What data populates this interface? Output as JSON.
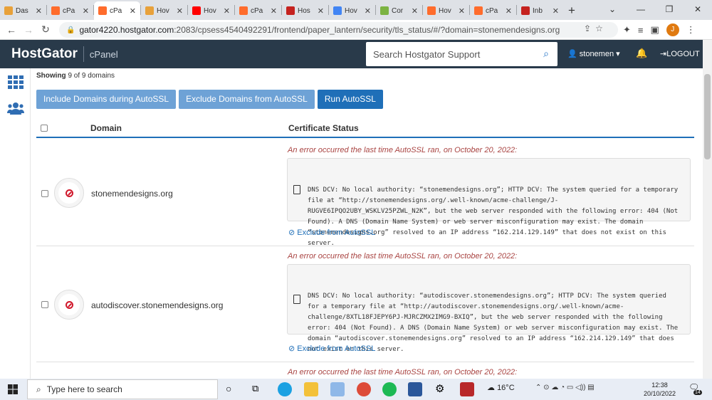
{
  "browser": {
    "tabs": [
      {
        "title": "Das",
        "color": "#e8a13a"
      },
      {
        "title": "cPa",
        "color": "#ff6c2c"
      },
      {
        "title": "cPa",
        "color": "#ff6c2c",
        "active": true
      },
      {
        "title": "Hov",
        "color": "#e8a13a"
      },
      {
        "title": "Hov",
        "color": "#ff0000"
      },
      {
        "title": "cPa",
        "color": "#ff6c2c"
      },
      {
        "title": "Hos",
        "color": "#c5221f"
      },
      {
        "title": "Hov",
        "color": "#4285f4"
      },
      {
        "title": "Cor",
        "color": "#7cb342"
      },
      {
        "title": "Hov",
        "color": "#ff6c2c"
      },
      {
        "title": "cPa",
        "color": "#ff6c2c"
      },
      {
        "title": "Inb",
        "color": "#c5221f"
      }
    ],
    "url_host": "gator4220.hostgator.com",
    "url_rest": ":2083/cpsess4540492291/frontend/paper_lantern/security/tls_status/#/?domain=stonemendesigns.org",
    "profile_initial": "J"
  },
  "header": {
    "logo": "HostGator",
    "product": "cPanel",
    "search_placeholder": "Search Hostgator Support",
    "username": "stonemen",
    "logout": "LOGOUT"
  },
  "toolbar": {
    "showing_prefix": "Showing",
    "showing_counts": "9 of 9 domains",
    "include_button": "Include Domains during AutoSSL",
    "exclude_button": "Exclude Domains from AutoSSL",
    "run_button": "Run AutoSSL"
  },
  "table": {
    "col_domain": "Domain",
    "col_status": "Certificate Status",
    "rows": [
      {
        "domain": "stonemendesigns.org",
        "error_heading": "An error occurred the last time AutoSSL ran, on October 20, 2022:",
        "message": "DNS DCV: No local authority: “stonemendesigns.org”; HTTP DCV: The system queried for a temporary file at “http://stonemendesigns.org/.well-known/acme-challenge/J-RUGVE6IPQO2UBY_WSKLV25PZWL_N2K”, but the web server responded with the following error: 404 (Not Found). A DNS (Domain Name System) or web server misconfiguration may exist. The domain “stonemendesigns.org” resolved to an IP address “162.214.129.149” that does not exist on this server.",
        "exclude_link": "Exclude from AutoSSL"
      },
      {
        "domain": "autodiscover.stonemendesigns.org",
        "error_heading": "An error occurred the last time AutoSSL ran, on October 20, 2022:",
        "message": "DNS DCV: No local authority: “autodiscover.stonemendesigns.org”; HTTP DCV: The system queried for a temporary file at “http://autodiscover.stonemendesigns.org/.well-known/acme-challenge/8XTL18FJEPY6PJ-MJRCZMX2IMG9-BXIQ”, but the web server responded with the following error: 404 (Not Found). A DNS (Domain Name System) or web server misconfiguration may exist. The domain “autodiscover.stonemendesigns.org” resolved to an IP address “162.214.129.149” that does not exist on this server.",
        "exclude_link": "Exclude from AutoSSL"
      },
      {
        "error_heading": "An error occurred the last time AutoSSL ran, on October 20, 2022:"
      }
    ]
  },
  "taskbar": {
    "search_placeholder": "Type here to search",
    "weather": "16°C",
    "time": "12:38",
    "date": "20/10/2022",
    "notification_count": "14"
  }
}
